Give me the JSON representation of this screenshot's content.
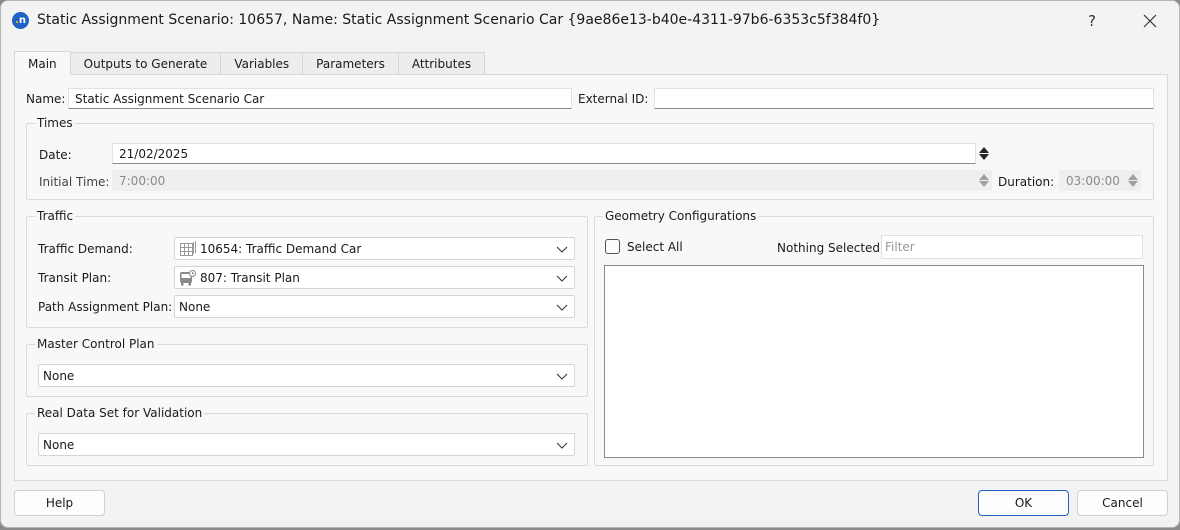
{
  "window": {
    "title": "Static Assignment Scenario: 10657, Name: Static Assignment Scenario Car  {9ae86e13-b40e-4311-97b6-6353c5f384f0}",
    "help_button": "?",
    "close_button": "✕",
    "app_icon_letter": "n",
    "accent_color": "#1f63c6"
  },
  "tabs": [
    {
      "label": "Main",
      "active": true
    },
    {
      "label": "Outputs to Generate",
      "active": false
    },
    {
      "label": "Variables",
      "active": false
    },
    {
      "label": "Parameters",
      "active": false
    },
    {
      "label": "Attributes",
      "active": false
    }
  ],
  "main": {
    "name_label": "Name:",
    "name_value": "Static Assignment Scenario Car",
    "external_id_label": "External ID:",
    "external_id_value": "",
    "times": {
      "title": "Times",
      "date_label": "Date:",
      "date_value": "21/02/2025",
      "initial_time_label": "Initial Time:",
      "initial_time_value": "7:00:00",
      "duration_label": "Duration:",
      "duration_value": "03:00:00"
    },
    "traffic": {
      "title": "Traffic",
      "traffic_demand_label": "Traffic Demand:",
      "traffic_demand_value": "10654: Traffic Demand Car",
      "transit_plan_label": "Transit Plan:",
      "transit_plan_value": "807: Transit Plan",
      "path_assignment_label": "Path Assignment Plan:",
      "path_assignment_value": "None"
    },
    "master_control_plan": {
      "title": "Master Control Plan",
      "value": "None"
    },
    "real_data_set": {
      "title": "Real Data Set for Validation",
      "value": "None"
    },
    "geometry": {
      "title": "Geometry Configurations",
      "select_all_label": "Select All",
      "select_all_checked": false,
      "selection_status": "Nothing Selected",
      "filter_placeholder": "Filter",
      "items": []
    }
  },
  "footer": {
    "help_label": "Help",
    "ok_label": "OK",
    "cancel_label": "Cancel"
  }
}
